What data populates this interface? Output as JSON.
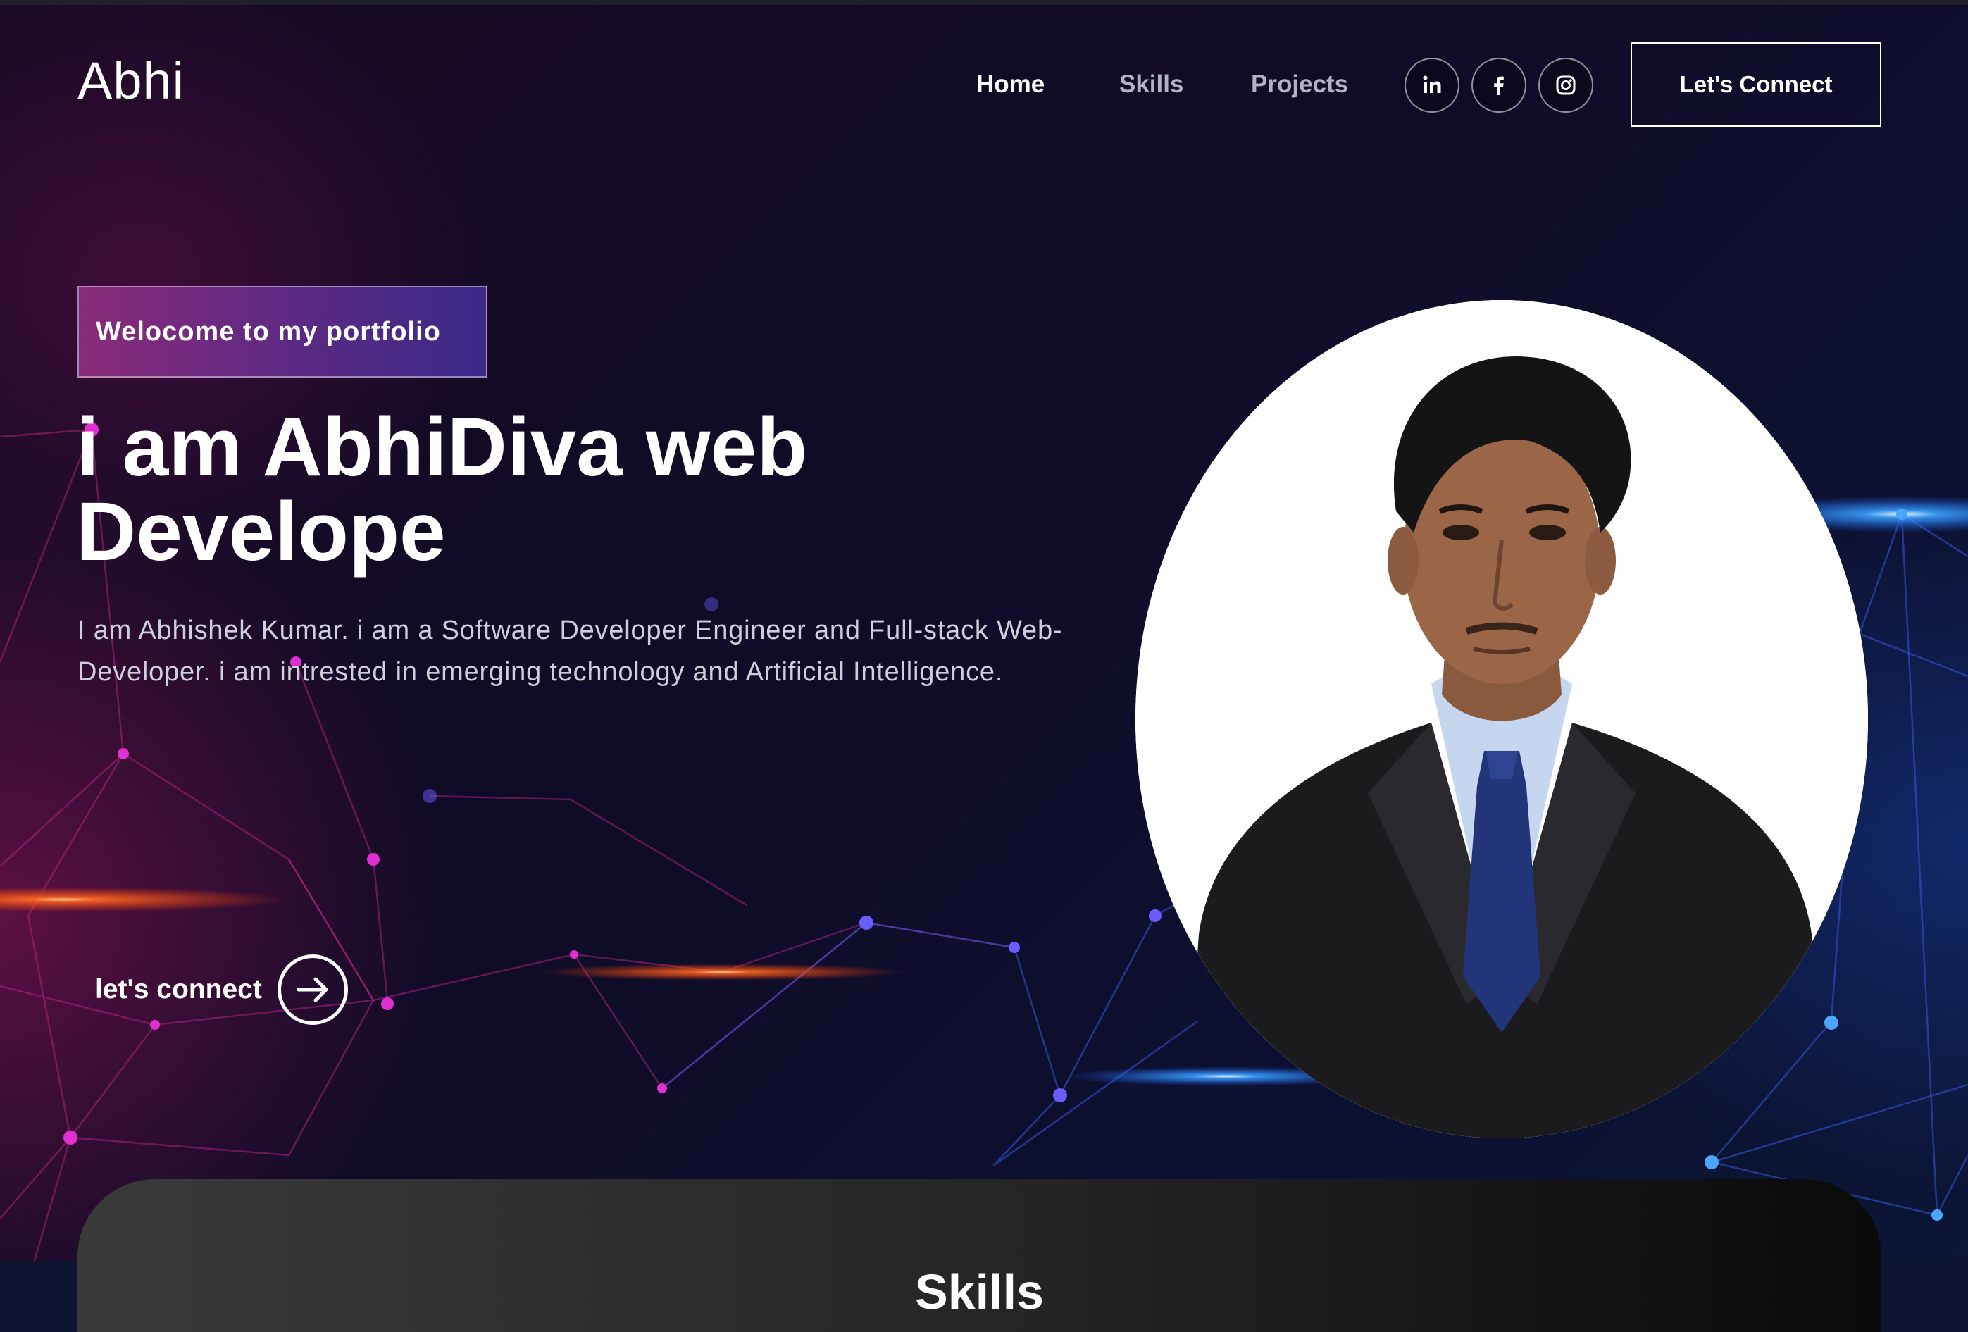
{
  "brand": {
    "name": "Abhi"
  },
  "nav": {
    "links": [
      {
        "label": "Home"
      },
      {
        "label": "Skills"
      },
      {
        "label": "Projects"
      }
    ],
    "social": [
      {
        "icon": "linkedin-icon"
      },
      {
        "icon": "facebook-icon"
      },
      {
        "icon": "instagram-icon"
      }
    ],
    "connect_label": "Let's Connect"
  },
  "hero": {
    "tagline": "Welocome to my portfolio",
    "headline_line1": "i am AbhiDiva web",
    "headline_line2": "Develope",
    "intro": "I am Abhishek Kumar. i am a Software Developer Engineer and Full-stack Web-Developer. i am intrested in emerging technology and Artificial Intelligence.",
    "cta_label": "let's connect",
    "cta_icon": "arrow-right-circle-icon"
  },
  "skills": {
    "title": "Skills"
  },
  "colors": {
    "background": "#0c0d1f",
    "tagline_start": "#8a2a7a",
    "tagline_end": "#3b2a88",
    "accent_magenta": "#d62bd0",
    "accent_blue": "#3d8cff"
  }
}
